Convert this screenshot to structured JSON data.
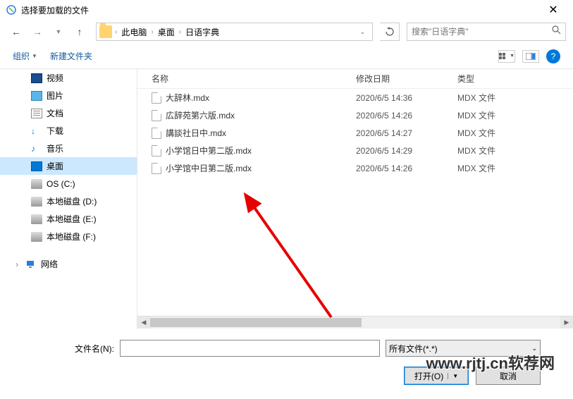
{
  "window": {
    "title": "选择要加载的文件"
  },
  "breadcrumb": {
    "root": "此电脑",
    "mid": "桌面",
    "leaf": "日语字典"
  },
  "search": {
    "placeholder": "搜索\"日语字典\""
  },
  "toolbar": {
    "organize": "组织",
    "newfolder": "新建文件夹"
  },
  "sidebar": {
    "items": [
      {
        "label": "视频",
        "icon": "video",
        "sub": true
      },
      {
        "label": "图片",
        "icon": "pic",
        "sub": true
      },
      {
        "label": "文档",
        "icon": "doc",
        "sub": true
      },
      {
        "label": "下载",
        "icon": "down",
        "sub": true
      },
      {
        "label": "音乐",
        "icon": "music",
        "sub": true
      },
      {
        "label": "桌面",
        "icon": "desk",
        "sub": true,
        "selected": true
      },
      {
        "label": "OS (C:)",
        "icon": "disk",
        "sub": true
      },
      {
        "label": "本地磁盘 (D:)",
        "icon": "disk",
        "sub": true
      },
      {
        "label": "本地磁盘 (E:)",
        "icon": "disk",
        "sub": true
      },
      {
        "label": "本地磁盘 (F:)",
        "icon": "disk",
        "sub": true
      }
    ],
    "network": "网络"
  },
  "columns": {
    "name": "名称",
    "date": "修改日期",
    "type": "类型"
  },
  "files": [
    {
      "name": "大辞林.mdx",
      "date": "2020/6/5 14:36",
      "type": "MDX 文件"
    },
    {
      "name": "広辞苑第六版.mdx",
      "date": "2020/6/5 14:26",
      "type": "MDX 文件"
    },
    {
      "name": "講談社日中.mdx",
      "date": "2020/6/5 14:27",
      "type": "MDX 文件"
    },
    {
      "name": "小学馆日中第二版.mdx",
      "date": "2020/6/5 14:29",
      "type": "MDX 文件"
    },
    {
      "name": "小学馆中日第二版.mdx",
      "date": "2020/6/5 14:26",
      "type": "MDX 文件"
    }
  ],
  "footer": {
    "filename_label": "文件名(N):",
    "filter": "所有文件(*.*)",
    "open": "打开(O)",
    "cancel": "取消"
  },
  "watermark": "www.rjtj.cn软荐网"
}
